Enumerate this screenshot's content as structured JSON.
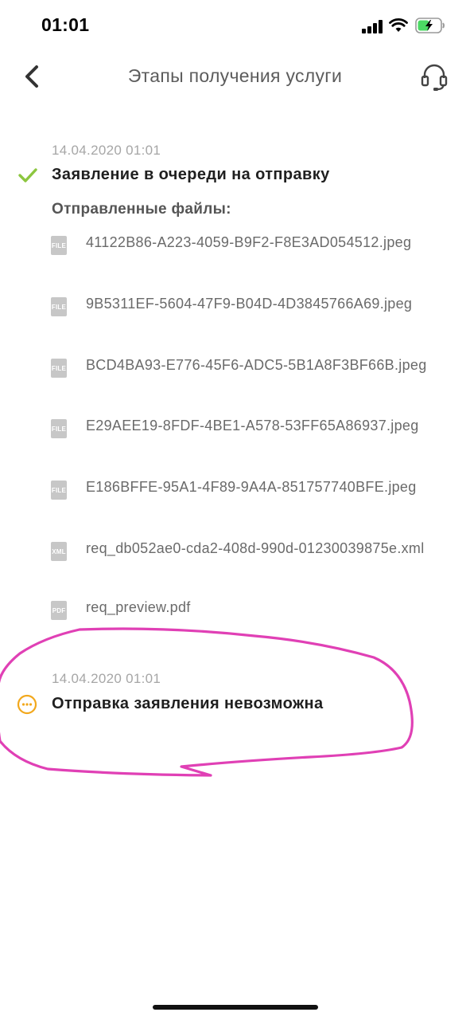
{
  "status_bar": {
    "time": "01:01"
  },
  "nav": {
    "title": "Этапы получения услуги",
    "back_icon": "chevron-left-icon",
    "support_icon": "headset-icon"
  },
  "steps": [
    {
      "date": "14.04.2020 01:01",
      "title": "Заявление в очереди на отправку",
      "status": "done",
      "status_icon": "checkmark-icon",
      "status_color": "#8cc63f",
      "files_heading": "Отправленные файлы:",
      "files": [
        {
          "type": "FILE",
          "name": "41122B86-A223-4059-B9F2-F8E3AD054512.jpeg"
        },
        {
          "type": "FILE",
          "name": "9B5311EF-5604-47F9-B04D-4D3845766A69.jpeg"
        },
        {
          "type": "FILE",
          "name": "BCD4BA93-E776-45F6-ADC5-5B1A8F3BF66B.jpeg"
        },
        {
          "type": "FILE",
          "name": "E29AEE19-8FDF-4BE1-A578-53FF65A86937.jpeg"
        },
        {
          "type": "FILE",
          "name": "E186BFFE-95A1-4F89-9A4A-851757740BFE.jpeg"
        },
        {
          "type": "XML",
          "name": "req_db052ae0-cda2-408d-990d-01230039875e.xml"
        },
        {
          "type": "PDF",
          "name": "req_preview.pdf"
        }
      ]
    },
    {
      "date": "14.04.2020 01:01",
      "title": "Отправка заявления невозможна",
      "status": "pending",
      "status_icon": "pending-dots-icon",
      "status_color": "#f2a81d"
    }
  ],
  "annotation_color": "#e040b5"
}
